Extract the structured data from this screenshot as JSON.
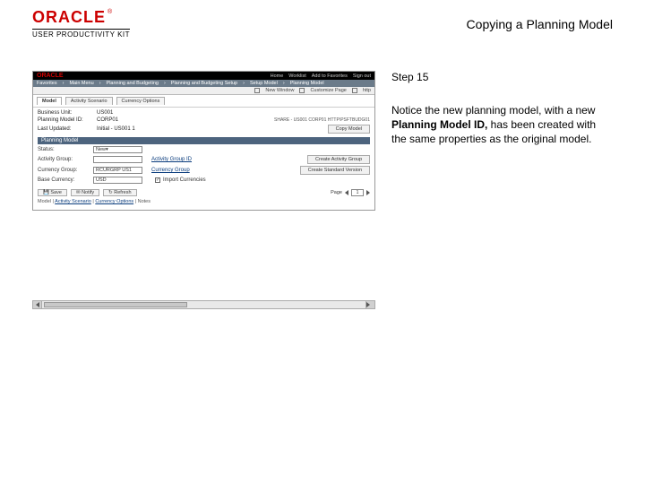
{
  "header": {
    "brand": "ORACLE",
    "tm": "®",
    "subbrand": "USER PRODUCTIVITY KIT",
    "title": "Copying a Planning Model"
  },
  "right": {
    "step": "Step 15",
    "text_a": "Notice the new planning model, with a new ",
    "text_bold": "Planning Model ID,",
    "text_b": " has been created with the same properties as the original model."
  },
  "app": {
    "topbrand": "ORACLE",
    "top_links": [
      "Home",
      "Worklist",
      "Add to Favorites",
      "Sign out"
    ],
    "main_tabs": [
      "Favorites",
      "Main Menu",
      "Planning and Budgeting",
      "Planning and Budgeting Setup",
      "Setup Model",
      "Planning Model"
    ],
    "util": {
      "newwin": "New Window",
      "custpg": "Customize Page",
      "help": "http"
    },
    "sec_tabs": [
      "Model",
      "Activity Scenario",
      "Currency Options"
    ],
    "info": {
      "bu_label": "Business Unit:",
      "bu_val": "US001",
      "bu_ext": "",
      "pmid_label": "Planning Model ID:",
      "pmid_val": "CORP01",
      "pmid_ext": "SHARE - US001 CORP01 HTTP\\PSFTBUDG01",
      "lu_label": "Last Updated:",
      "lu_val": "Initial - US001 1"
    },
    "btn_copy": "Copy Model",
    "section": "Planning Model",
    "form": {
      "status_l": "Status:",
      "status_v": "New",
      "ag_l": "Activity Group:",
      "ag_v": "",
      "ag_link": "Activity Group ID",
      "ag_btn": "Create Activity Group",
      "cg_l": "Currency Group:",
      "cg_v": "RCURGRP US1",
      "cg_link": "Currency Group",
      "cg_btn": "Create Standard Version",
      "bc_l": "Base Currency:",
      "bc_v": "USD",
      "bc_chk_l": "Import Currencies"
    },
    "footer": {
      "save": "Save",
      "notify": "Notify",
      "refresh": "Refresh",
      "page": "Page",
      "page_v": "1"
    },
    "help_line": {
      "pre": "Model | ",
      "a": "Activity Scenario",
      "mid": " | ",
      "b": "Currency Options",
      "suf": " | Notes"
    }
  }
}
